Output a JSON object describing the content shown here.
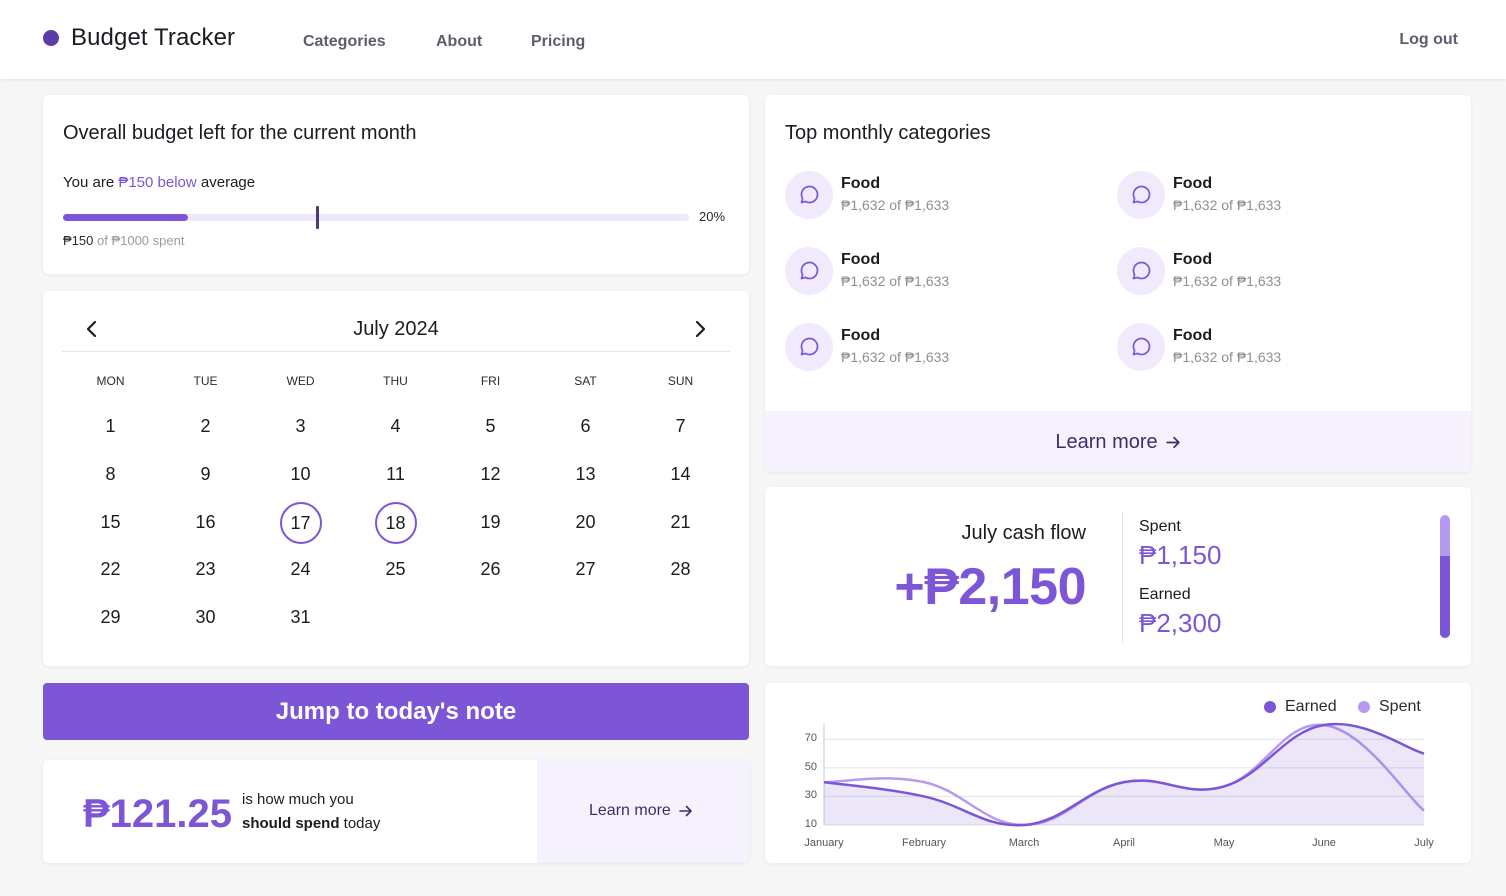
{
  "nav": {
    "brand": "Budget Tracker",
    "links": [
      "Categories",
      "About",
      "Pricing"
    ],
    "logout": "Log out"
  },
  "budget": {
    "title": "Overall budget left for the current month",
    "sub_prefix": "You are ",
    "sub_highlight": "₱150 below",
    "sub_suffix": " average",
    "percent_label": "20%",
    "fill_fraction": 0.2,
    "marker_fraction": 0.404,
    "spent_amount": "₱150",
    "spent_suffix": " of ₱1000 spent"
  },
  "calendar": {
    "title": "July 2024",
    "weekdays": [
      "MON",
      "TUE",
      "WED",
      "THU",
      "FRI",
      "SAT",
      "SUN"
    ],
    "days": [
      "1",
      "2",
      "3",
      "4",
      "5",
      "6",
      "7",
      "8",
      "9",
      "10",
      "11",
      "12",
      "13",
      "14",
      "15",
      "16",
      "17",
      "18",
      "19",
      "20",
      "21",
      "22",
      "23",
      "24",
      "25",
      "26",
      "27",
      "28",
      "29",
      "30",
      "31"
    ],
    "selected": [
      "17",
      "18"
    ],
    "first_weekday_index": 0
  },
  "jump_button": "Jump to today's note",
  "spend": {
    "amount": "₱121.25",
    "line1": "is how much you",
    "line2_bold": "should spend",
    "line2_rest": " today",
    "learn_more": "Learn more"
  },
  "categories": {
    "title": "Top monthly categories",
    "items": [
      {
        "name": "Food",
        "amount": "₱1,632 of ₱1,633"
      },
      {
        "name": "Food",
        "amount": "₱1,632 of ₱1,633"
      },
      {
        "name": "Food",
        "amount": "₱1,632 of ₱1,633"
      },
      {
        "name": "Food",
        "amount": "₱1,632 of ₱1,633"
      },
      {
        "name": "Food",
        "amount": "₱1,632 of ₱1,633"
      },
      {
        "name": "Food",
        "amount": "₱1,632 of ₱1,633"
      }
    ],
    "icon": "chat-bubble-icon",
    "learn_more": "Learn more"
  },
  "cashflow": {
    "title": "July cash flow",
    "net": "+₱2,150",
    "spent_label": "Spent",
    "spent_value": "₱1,150",
    "earned_label": "Earned",
    "earned_value": "₱2,300",
    "earned_fraction": 0.667
  },
  "colors": {
    "accent": "#7d56d7",
    "accent_light": "#b69af0",
    "brand_dot": "#5b3ca8"
  },
  "chart_data": {
    "type": "area",
    "categories": [
      "January",
      "February",
      "March",
      "April",
      "May",
      "June",
      "July"
    ],
    "series": [
      {
        "name": "Earned",
        "values": [
          40,
          30,
          10,
          40,
          37,
          80,
          60
        ],
        "color": "#7d56d7"
      },
      {
        "name": "Spent",
        "values": [
          40,
          40,
          10,
          40,
          37,
          80,
          20
        ],
        "color": "#b69af0"
      }
    ],
    "yticks": [
      10,
      30,
      50,
      70
    ],
    "ylim": [
      10,
      80
    ],
    "legend": "top-right",
    "grid": true
  }
}
